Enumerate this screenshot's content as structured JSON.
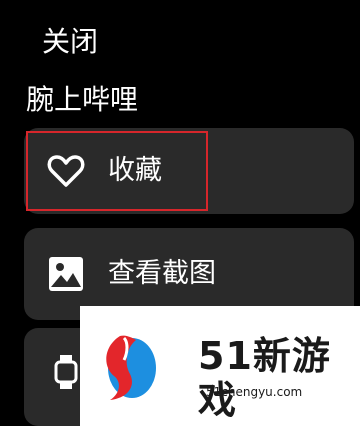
{
  "header": {
    "close_label": "关闭"
  },
  "app": {
    "title": "腕上哔哩"
  },
  "menu": {
    "favorite_label": "收藏",
    "screenshot_label": "查看截图"
  },
  "watermark": {
    "text": "51新游戏",
    "url": "51chengyu.com"
  },
  "colors": {
    "background": "#000000",
    "card": "#2a2a2a",
    "highlight": "#d6262b",
    "logo_red": "#e3262b",
    "logo_blue": "#1d8fe0"
  },
  "icons": [
    "heart-icon",
    "image-icon",
    "watch-sync-icon"
  ]
}
